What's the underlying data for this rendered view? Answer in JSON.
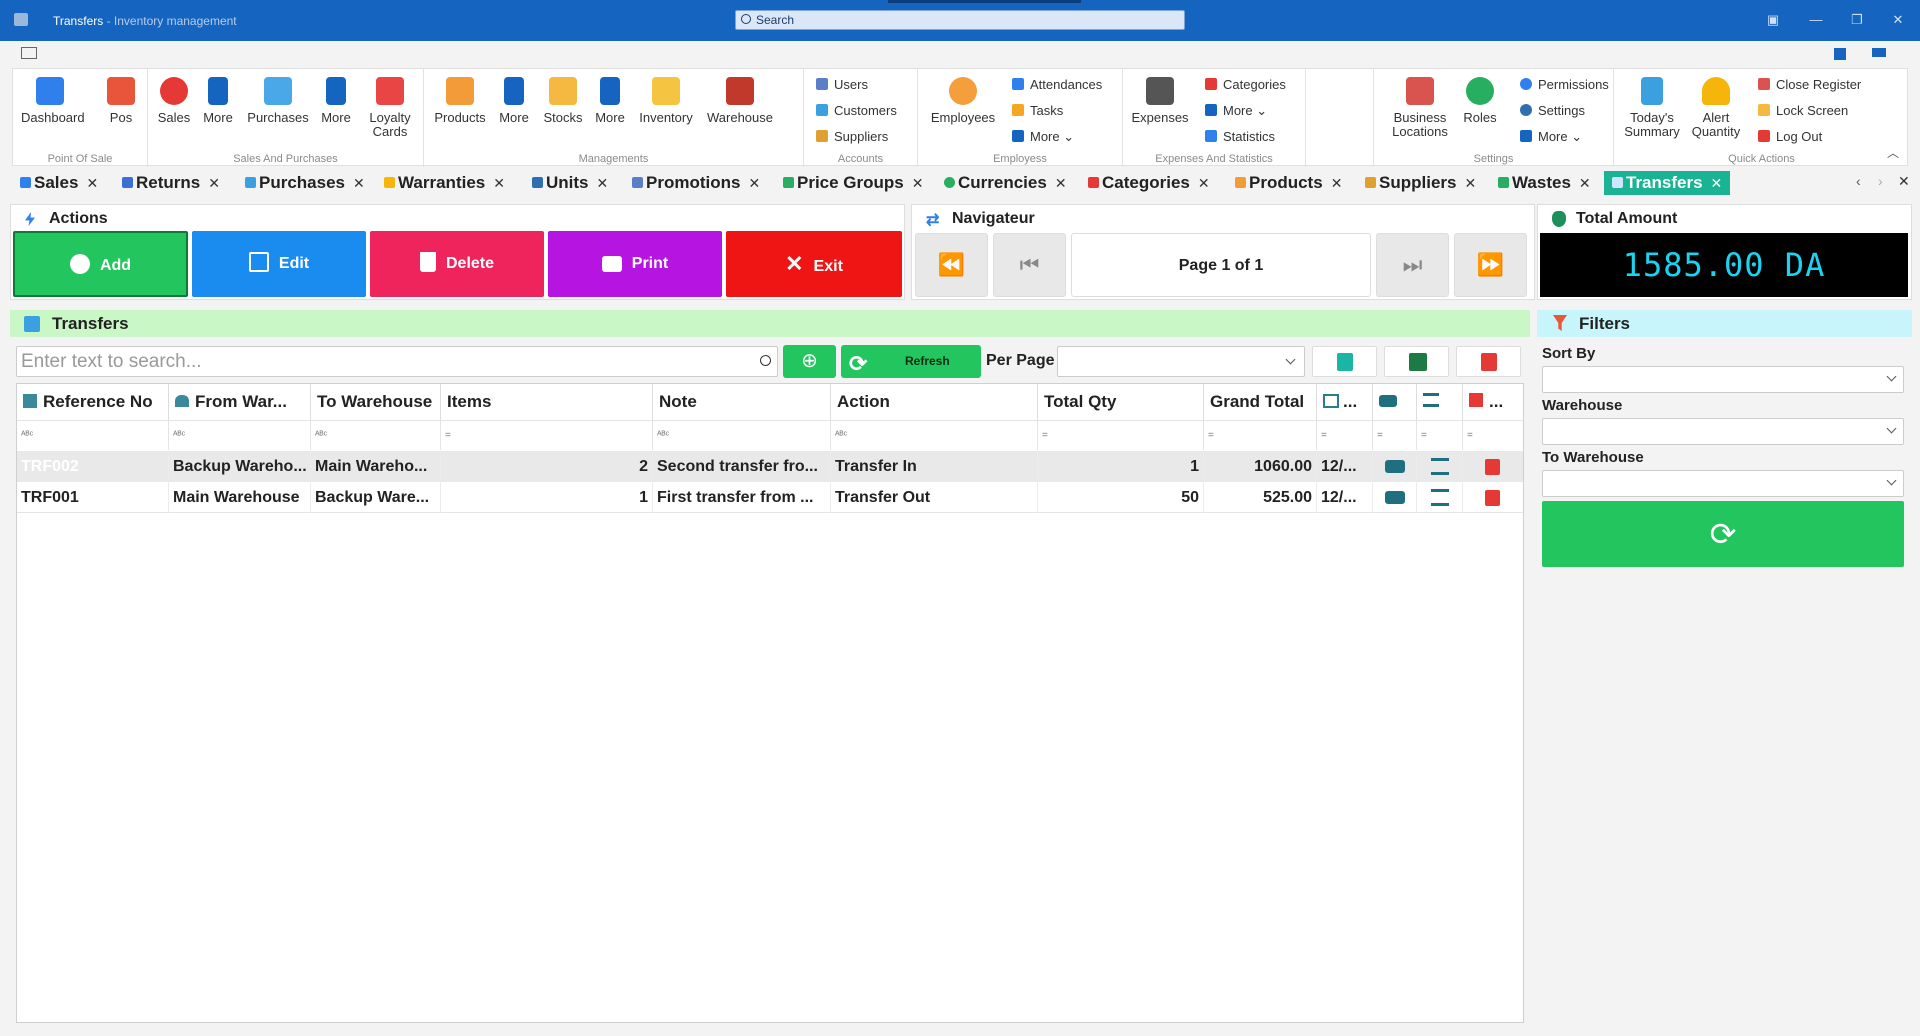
{
  "window": {
    "title": "Transfers",
    "subtitle": " - Inventory management",
    "search_placeholder": "Search"
  },
  "ribbon": {
    "groups": [
      "Point Of Sale",
      "Sales And Purchases",
      "Managements",
      "Accounts",
      "Employess",
      "Expenses And Statistics",
      "Settings",
      "Quick Actions"
    ],
    "buttons": {
      "dashboard": "Dashboard",
      "pos": "Pos",
      "sales": "Sales",
      "more1": "More",
      "purchases": "Purchases",
      "more2": "More",
      "loyalty": "Loyalty Cards",
      "products": "Products",
      "more3": "More",
      "stocks": "Stocks",
      "more4": "More",
      "inventory": "Inventory",
      "warehouse": "Warehouse",
      "users": "Users",
      "customers": "Customers",
      "suppliers": "Suppliers",
      "employees": "Employees",
      "attendances": "Attendances",
      "tasks": "Tasks",
      "more5": "More",
      "expenses": "Expenses",
      "categories": "Categories",
      "more6": "More",
      "statistics": "Statistics",
      "business": "Business Locations",
      "roles": "Roles",
      "permissions": "Permissions",
      "settings": "Settings",
      "more7": "More",
      "today": "Today's Summary",
      "alert": "Alert Quantity",
      "close_register": "Close Register",
      "lock": "Lock Screen",
      "logout": "Log Out"
    }
  },
  "tabs": [
    "Sales",
    "Returns",
    "Purchases",
    "Warranties",
    "Units",
    "Promotions",
    "Price Groups",
    "Currencies",
    "Categories",
    "Products",
    "Suppliers",
    "Wastes",
    "Transfers"
  ],
  "actions": {
    "title": "Actions",
    "add": "Add",
    "edit": "Edit",
    "delete": "Delete",
    "print": "Print",
    "exit": "Exit"
  },
  "navigator": {
    "title": "Navigateur",
    "page_text": "Page 1 of 1"
  },
  "total": {
    "title": "Total Amount",
    "value": "1585.00 DA"
  },
  "section_title": "Transfers",
  "search": {
    "placeholder": "Enter text to search...",
    "refresh": "Refresh",
    "per_page": "Per Page"
  },
  "grid": {
    "columns": [
      "Reference No",
      "From War...",
      "To Warehouse",
      "Items",
      "Note",
      "Action",
      "Total Qty",
      "Grand Total",
      "..."
    ],
    "rows": [
      {
        "ref": "TRF002",
        "from": "Backup Wareho...",
        "to": "Main Wareho...",
        "items": "2",
        "note": "Second transfer fro...",
        "action": "Transfer In",
        "qty": "1",
        "total": "1060.00",
        "date": "12/..."
      },
      {
        "ref": "TRF001",
        "from": "Main Warehouse",
        "to": "Backup Ware...",
        "items": "1",
        "note": "First transfer from ...",
        "action": "Transfer Out",
        "qty": "50",
        "total": "525.00",
        "date": "12/..."
      }
    ]
  },
  "filters": {
    "title": "Filters",
    "sort_by": "Sort By",
    "warehouse": "Warehouse",
    "to_warehouse": "To Warehouse"
  },
  "colors": {
    "titlebar": "#1565c0",
    "add": "#22c55e",
    "edit": "#1a8cf0",
    "delete": "#f0245c",
    "print": "#b614e0",
    "exit": "#ef1515",
    "accent": "#1ab394"
  }
}
